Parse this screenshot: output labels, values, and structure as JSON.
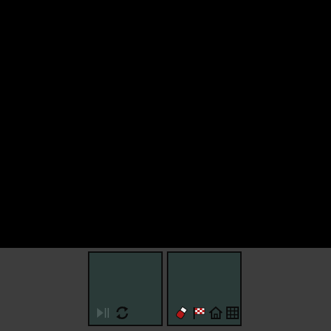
{
  "colors": {
    "viewport": "#000000",
    "bar": "#3d3d3d",
    "panel": "#2a3a38",
    "panel_border": "#0a0a0a",
    "icon_dark": "#0a0a0a",
    "icon_dim": "#4a5a58",
    "icon_red": "#b01818",
    "icon_white": "#f2f2f2"
  },
  "left_panel": {
    "buttons": [
      {
        "icon": "play-pause-icon",
        "state": "disabled"
      },
      {
        "icon": "refresh-icon",
        "state": "enabled"
      }
    ]
  },
  "right_panel": {
    "buttons": [
      {
        "icon": "potion-icon",
        "state": "enabled"
      },
      {
        "icon": "checkered-flag-icon",
        "state": "enabled"
      },
      {
        "icon": "home-icon",
        "state": "enabled"
      },
      {
        "icon": "grid-icon",
        "state": "enabled"
      }
    ]
  }
}
